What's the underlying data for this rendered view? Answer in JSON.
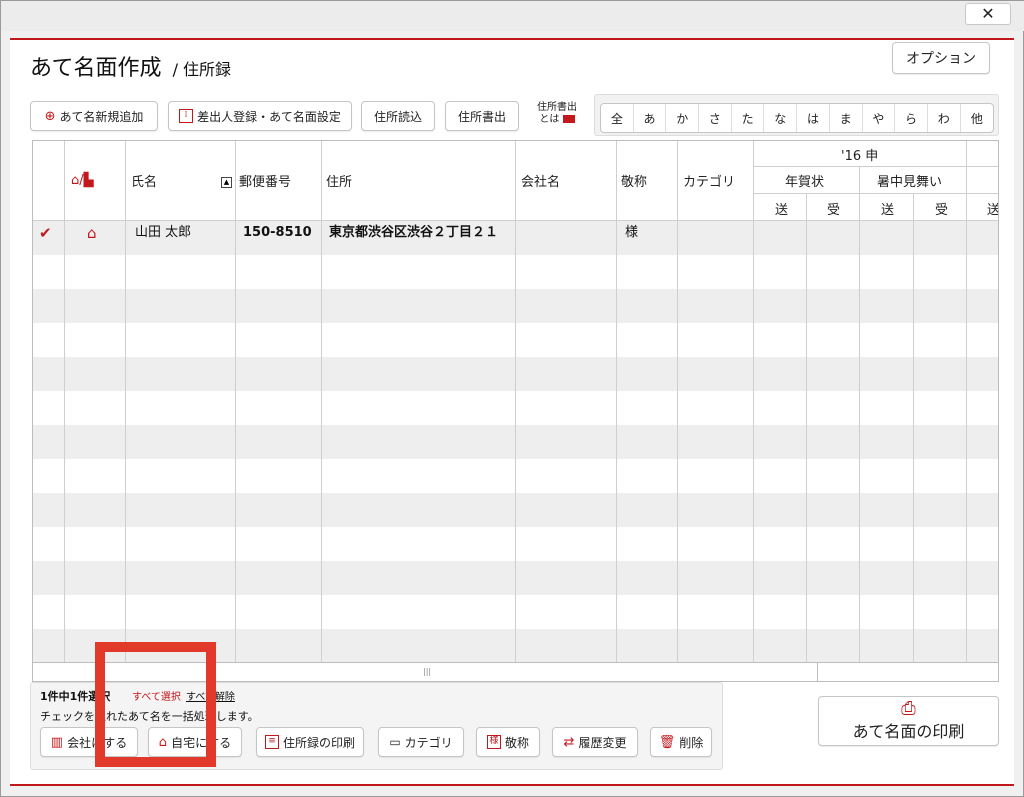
{
  "window": {
    "close_glyph": "✕"
  },
  "header": {
    "title": "あて名面作成",
    "subtitle": "/ 住所録",
    "option_label": "オプション"
  },
  "toolbar": {
    "new_label": "あて名新規追加",
    "sender_label": "差出人登録・あて名面設定",
    "import_label": "住所読込",
    "export_label": "住所書出",
    "export_info_line1": "住所書出",
    "export_info_line2": "とは"
  },
  "kana_tabs": [
    "全",
    "あ",
    "か",
    "さ",
    "た",
    "な",
    "は",
    "ま",
    "や",
    "ら",
    "わ",
    "他"
  ],
  "table": {
    "headers": {
      "name": "氏名",
      "postal": "郵便番号",
      "address": "住所",
      "company": "会社名",
      "honorific": "敬称",
      "category": "カテゴリ",
      "year": "'16 申",
      "nenga": "年賀状",
      "shochu": "暑中見舞い",
      "send": "送",
      "recv": "受"
    },
    "rows": [
      {
        "checked": true,
        "type_icon": "home-icon",
        "name": "山田 太郎",
        "postal": "150-8510",
        "address": "東京都渋谷区渋谷２丁目２１",
        "company": "",
        "honorific": "様",
        "category": ""
      }
    ]
  },
  "footer": {
    "selection_count": "1件中1件選択",
    "select_all": "すべて選択",
    "deselect_all": "すべて解除",
    "hint": "チェックを入れたあて名を一括処理します。",
    "buttons": {
      "company": "会社にする",
      "home": "自宅にする",
      "print_list": "住所録の印刷",
      "category": "カテゴリ",
      "honorific": "敬称",
      "history": "履歴変更",
      "delete": "削除"
    },
    "print_label": "あて名面の印刷"
  },
  "colors": {
    "accent": "#c2171b",
    "highlight": "#e23a2a"
  }
}
